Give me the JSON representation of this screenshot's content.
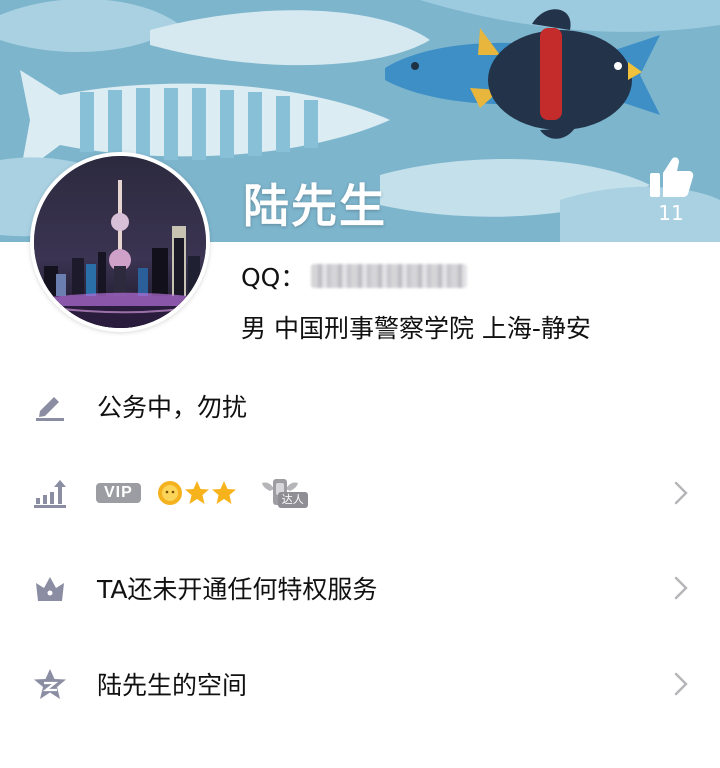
{
  "profile": {
    "nickname": "陆先生",
    "like_count": "11",
    "qq_label": "QQ：",
    "info": "男 中国刑事警察学院 上海-静安"
  },
  "rows": {
    "signature": "公务中，勿扰",
    "vip_label": "VIP",
    "daren_label": "达人",
    "privilege": "TA还未开通任何特权服务",
    "space": "陆先生的空间"
  },
  "icons": {
    "like": "thumbs-up-icon",
    "signature": "pencil-icon",
    "level": "level-chart-icon",
    "privilege": "crown-icon",
    "space": "qzone-star-icon",
    "chevron": "chevron-right-icon"
  },
  "colors": {
    "cover_background": "#7fb7cf",
    "icon_gray": "#8b8ea3",
    "text": "#111111",
    "vip_tag": "#9c9ca3"
  }
}
